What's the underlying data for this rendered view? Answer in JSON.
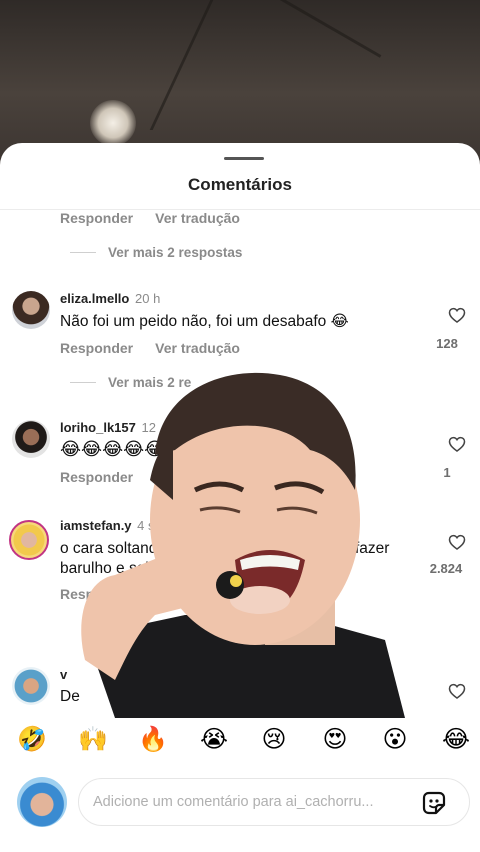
{
  "sheet": {
    "title": "Comentários"
  },
  "top_partial": {
    "reply": "Responder",
    "translate": "Ver tradução",
    "more_replies": "Ver mais 2 respostas"
  },
  "comments": [
    {
      "username": "eliza.lmello",
      "time": "20 h",
      "text": "Não foi um peido não, foi um desabafo 😂",
      "reply": "Responder",
      "translate": "Ver tradução",
      "likes": "128",
      "more_replies": "Ver mais 2 re"
    },
    {
      "username": "loriho_lk157",
      "time": "12",
      "text": "😂😂😂😂😂",
      "reply": "Responder",
      "likes": "1"
    },
    {
      "username": "iamstefan.y",
      "time": "4 sem",
      "text_line1": "o cara soltando o p",
      "text_line1_end": "fazer",
      "text_line2": "barulho e sai",
      "reply": "Respo",
      "likes": "2.824"
    },
    {
      "username": "v",
      "text": "De"
    }
  ],
  "emojis": [
    "🤣",
    "🙌",
    "🔥",
    "😭",
    "😢",
    "😍",
    "😮",
    "😂"
  ],
  "composer": {
    "placeholder": "Adicione um comentário para ai_cachorru..."
  },
  "icons": {
    "heart": "heart-icon",
    "sticker": "sticker-icon"
  }
}
